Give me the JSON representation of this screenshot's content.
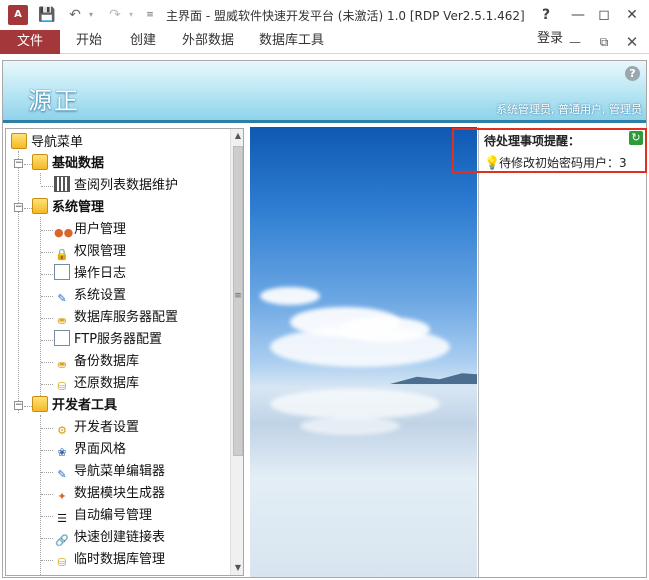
{
  "app": {
    "icon_text": "A",
    "window_title": "主界面 - 盟威软件快速开发平台 (未激活) 1.0 [RDP Ver2.5.1.462]",
    "help_glyph": "?"
  },
  "ribbon": {
    "file_label": "文件",
    "tabs": [
      "开始",
      "创建",
      "外部数据",
      "数据库工具"
    ],
    "login_label": "登录"
  },
  "banner": {
    "title": "源正",
    "user_info": "系统管理员, 普通用户, 管理员"
  },
  "nav": {
    "root": "导航菜单",
    "groups": [
      {
        "label": "基础数据",
        "items": [
          "查阅列表数据维护"
        ]
      },
      {
        "label": "系统管理",
        "items": [
          "用户管理",
          "权限管理",
          "操作日志",
          "系统设置",
          "数据库服务器配置",
          "FTP服务器配置",
          "备份数据库",
          "还原数据库"
        ]
      },
      {
        "label": "开发者工具",
        "items": [
          "开发者设置",
          "界面风格",
          "导航菜单编辑器",
          "数据模块生成器",
          "自动编号管理",
          "快速创建链接表",
          "临时数据库管理"
        ]
      }
    ]
  },
  "reminder": {
    "title": "待处理事项提醒：",
    "item": "待修改初始密码用户：3"
  },
  "colors": {
    "brand": "#a4373a",
    "highlight_border": "#e0301e",
    "banner_bottom": "#2f7ea6"
  }
}
